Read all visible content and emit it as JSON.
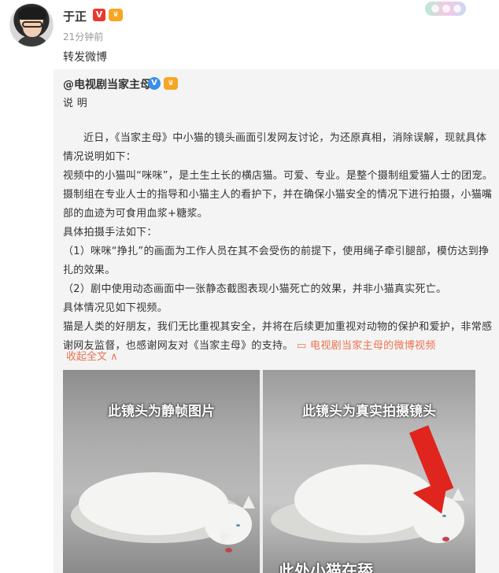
{
  "post": {
    "author": "于正",
    "verified_badge": "V",
    "level_badge": "♛",
    "timestamp": "21分钟前",
    "text": "转发微博"
  },
  "repost": {
    "author": "@电视剧当家主母",
    "verified_badge": "V",
    "level_badge": "♛",
    "title": "说 明",
    "paragraphs": [
      "近日，《当家主母》中小猫的镜头画面引发网友讨论，为还原真相，消除误解，现就具体情况说明如下：",
      "视频中的小猫叫“咪咪”，是土生土长的横店猫。可爱、专业。是整个摄制组爱猫人士的团宠。摄制组在专业人士的指导和小猫主人的看护下，并在确保小猫安全的情况下进行拍摄，小猫嘴部的血迹为可食用血浆+糖浆。",
      "具体拍摄手法如下：",
      "（1）咪咪“挣扎”的画面为工作人员在其不会受伤的前提下，使用绳子牵引腿部，模仿达到挣扎的效果。",
      "（2）剧中使用动态画面中一张静态截图表现小猫死亡的效果，并非小猫真实死亡。",
      "具体情况见如下视频。",
      "猫是人类的好朋友，我们无比重视其安全，并将在后续更加重视对动物的保护和爱护，非常感谢网友监督，也感谢网友对《当家主母》的支持。"
    ],
    "video_link": "▭ 电视剧当家主母的微博视频",
    "collapse_label": "收起全文 ∧",
    "image_left_caption": "此镜头为静帧图片",
    "image_right_caption": "此镜头为真实拍摄镜头",
    "image_right_bottom_caption": "此处小猫在舔"
  },
  "colors": {
    "link": "#eb7350",
    "repost_bg": "#f4f4f4",
    "verified_red": "#e8392e",
    "verified_blue": "#3a8ee6"
  }
}
